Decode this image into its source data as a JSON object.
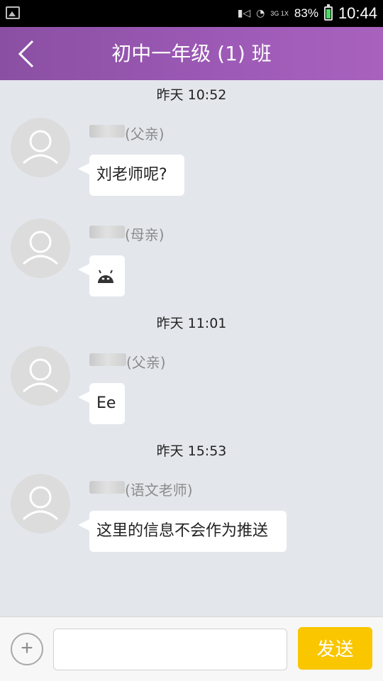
{
  "status_bar": {
    "network": "3G 1X",
    "battery_percent": "83%",
    "time": "10:44"
  },
  "header": {
    "title": "初中一年级 (1) 班"
  },
  "messages": [
    {
      "time": "昨天 10:52",
      "role": "(父亲)",
      "text": "刘老师呢?"
    },
    {
      "role": "(母亲)",
      "emoji": "android-face-icon"
    },
    {
      "time": "昨天 11:01",
      "role": "(父亲)",
      "text": "Ee"
    },
    {
      "time": "昨天 15:53",
      "role": "(语文老师)",
      "text": "这里的信息不会作为推送"
    }
  ],
  "input_bar": {
    "placeholder": "",
    "send_label": "发送",
    "plus_icon": "plus-icon"
  },
  "colors": {
    "header": "#9b55b3",
    "send": "#f9c600",
    "background": "#e3e7ec"
  }
}
